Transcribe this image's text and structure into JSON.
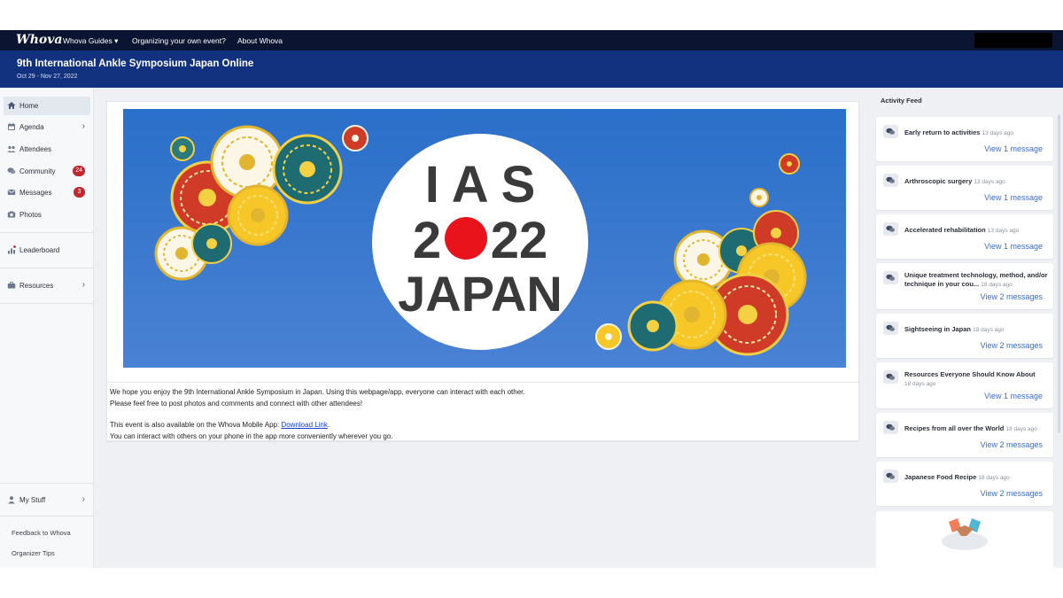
{
  "nav": {
    "logo": "Whova",
    "links": [
      "Whova Guides ▾",
      "Organizing your own event?",
      "About Whova"
    ]
  },
  "event": {
    "title": "9th International Ankle Symposium Japan Online",
    "dates": "Oct 29 - Nov 27, 2022"
  },
  "sidebar": {
    "items": [
      {
        "label": "Home",
        "icon": "home-icon"
      },
      {
        "label": "Agenda",
        "icon": "calendar-icon"
      },
      {
        "label": "Attendees",
        "icon": "people-icon"
      },
      {
        "label": "Community",
        "icon": "chat-icon",
        "badge": "24"
      },
      {
        "label": "Messages",
        "icon": "mail-icon",
        "badge": "3"
      },
      {
        "label": "Photos",
        "icon": "camera-icon"
      },
      {
        "label": "Leaderboard",
        "icon": "bar-chart-icon"
      },
      {
        "label": "Resources",
        "icon": "briefcase-icon"
      },
      {
        "label": "My Stuff",
        "icon": "user-icon"
      }
    ],
    "footer": [
      "Feedback to Whova",
      "Organizer Tips"
    ]
  },
  "banner": {
    "line1": "I A S",
    "line2a": "2",
    "line2b": "22",
    "line3": "JAPAN",
    "colors": {
      "sky": "#3f7fd0",
      "disc": "#ffffff",
      "sun": "#e8131b",
      "text": "#3a3a3a"
    }
  },
  "description": {
    "line1": "We hope you enjoy the 9th International Ankle Symposium in Japan. Using this webpage/app, everyone can interact with each other.",
    "line2": "Please feel free to post photos and comments and connect with other attendees!",
    "line3_prefix": "This event is also available on the Whova Mobile App: ",
    "link": "Download Link",
    "line3_suffix": ".",
    "line4": "You can interact with others on your phone in the app more conveniently wherever you go."
  },
  "feed": {
    "title": "Activity Feed",
    "items": [
      {
        "title": "Early return to activities",
        "ago": "13 days ago",
        "link": "View 1 message"
      },
      {
        "title": "Arthroscopic surgery",
        "ago": "13 days ago",
        "link": "View 1 message"
      },
      {
        "title": "Accelerated rehabilitation",
        "ago": "13 days ago",
        "link": "View 1 message"
      },
      {
        "title": "Unique treatment technology, method, and/or technique in your cou...",
        "ago": "18 days ago",
        "link": "View 2 messages"
      },
      {
        "title": "Sightseeing in Japan",
        "ago": "18 days ago",
        "link": "View 2 messages"
      },
      {
        "title": "Resources Everyone Should Know About",
        "ago": "18 days ago",
        "link": "View 1 message"
      },
      {
        "title": "Recipes from all over the World",
        "ago": "18 days ago",
        "link": "View 2 messages"
      },
      {
        "title": "Japanese Food Recipe",
        "ago": "18 days ago",
        "link": "View 2 messages"
      }
    ]
  },
  "colors": {
    "nav_bg": "#0b1430",
    "header_bg": "#12317f",
    "badge": "#c0262d",
    "link": "#3a6ec9"
  }
}
